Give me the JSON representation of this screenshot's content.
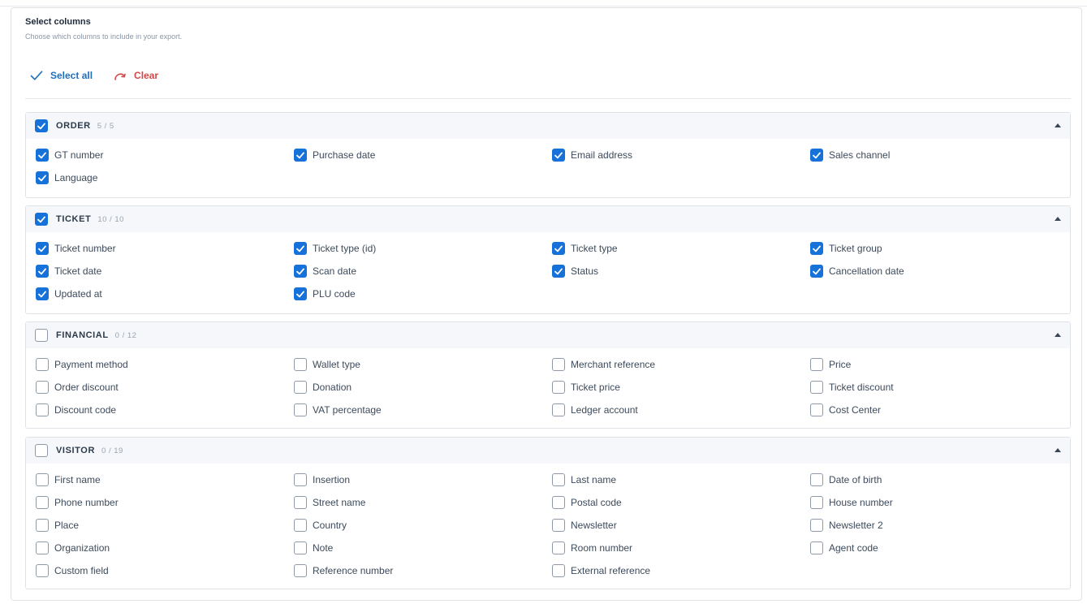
{
  "header": {
    "title": "Select columns",
    "subtitle": "Choose which columns to include in your export."
  },
  "actions": {
    "select_all": "Select all",
    "clear": "Clear"
  },
  "colors": {
    "accent": "#1672d9",
    "select_all": "#1f6fbf",
    "clear": "#d64545"
  },
  "groups": [
    {
      "name": "ORDER",
      "count": "5 / 5",
      "checked": true,
      "items": [
        {
          "label": "GT number",
          "checked": true
        },
        {
          "label": "Purchase date",
          "checked": true
        },
        {
          "label": "Email address",
          "checked": true
        },
        {
          "label": "Sales channel",
          "checked": true
        },
        {
          "label": "Language",
          "checked": true
        }
      ]
    },
    {
      "name": "TICKET",
      "count": "10 / 10",
      "checked": true,
      "items": [
        {
          "label": "Ticket number",
          "checked": true
        },
        {
          "label": "Ticket type (id)",
          "checked": true
        },
        {
          "label": "Ticket type",
          "checked": true
        },
        {
          "label": "Ticket group",
          "checked": true
        },
        {
          "label": "Ticket date",
          "checked": true
        },
        {
          "label": "Scan date",
          "checked": true
        },
        {
          "label": "Status",
          "checked": true
        },
        {
          "label": "Cancellation date",
          "checked": true
        },
        {
          "label": "Updated at",
          "checked": true
        },
        {
          "label": "PLU code",
          "checked": true
        }
      ]
    },
    {
      "name": "FINANCIAL",
      "count": "0 / 12",
      "checked": false,
      "items": [
        {
          "label": "Payment method",
          "checked": false
        },
        {
          "label": "Wallet type",
          "checked": false
        },
        {
          "label": "Merchant reference",
          "checked": false
        },
        {
          "label": "Price",
          "checked": false
        },
        {
          "label": "Order discount",
          "checked": false
        },
        {
          "label": "Donation",
          "checked": false
        },
        {
          "label": "Ticket price",
          "checked": false
        },
        {
          "label": "Ticket discount",
          "checked": false
        },
        {
          "label": "Discount code",
          "checked": false
        },
        {
          "label": "VAT percentage",
          "checked": false
        },
        {
          "label": "Ledger account",
          "checked": false
        },
        {
          "label": "Cost Center",
          "checked": false
        }
      ]
    },
    {
      "name": "VISITOR",
      "count": "0 / 19",
      "checked": false,
      "items": [
        {
          "label": "First name",
          "checked": false
        },
        {
          "label": "Insertion",
          "checked": false
        },
        {
          "label": "Last name",
          "checked": false
        },
        {
          "label": "Date of birth",
          "checked": false
        },
        {
          "label": "Phone number",
          "checked": false
        },
        {
          "label": "Street name",
          "checked": false
        },
        {
          "label": "Postal code",
          "checked": false
        },
        {
          "label": "House number",
          "checked": false
        },
        {
          "label": "Place",
          "checked": false
        },
        {
          "label": "Country",
          "checked": false
        },
        {
          "label": "Newsletter",
          "checked": false
        },
        {
          "label": "Newsletter 2",
          "checked": false
        },
        {
          "label": "Organization",
          "checked": false
        },
        {
          "label": "Note",
          "checked": false
        },
        {
          "label": "Room number",
          "checked": false
        },
        {
          "label": "Agent code",
          "checked": false
        },
        {
          "label": "Custom field",
          "checked": false
        },
        {
          "label": "Reference number",
          "checked": false
        },
        {
          "label": "External reference",
          "checked": false
        }
      ]
    }
  ]
}
